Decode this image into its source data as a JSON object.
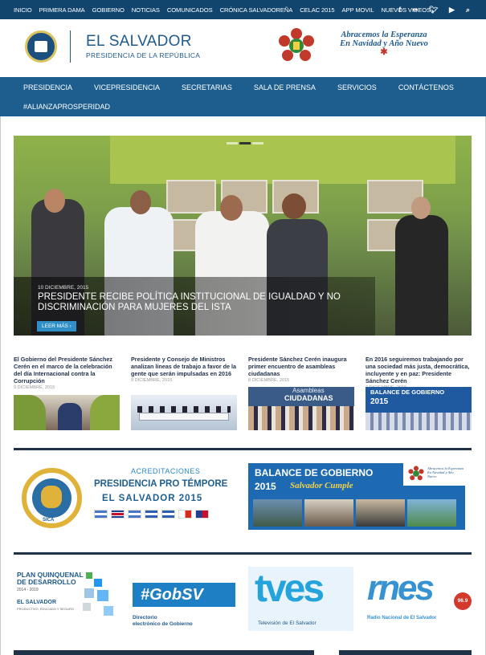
{
  "topbar": {
    "links": [
      "INICIO",
      "PRIMERA DAMA",
      "GOBIERNO",
      "NOTICIAS",
      "COMUNICADOS",
      "CRÓNICA SALVADOREÑA",
      "CELAC 2015",
      "APP MOVIL",
      "NUEVOS VIDEOS"
    ],
    "social_icons": [
      "facebook-icon",
      "flickr-icon",
      "twitter-icon",
      "youtube-icon",
      "search-icon"
    ]
  },
  "header": {
    "title": "EL SALVADOR",
    "subtitle": "PRESIDENCIA DE LA REPÚBLICA",
    "campaign_line1": "Abracemos la Esperanza",
    "campaign_line2": "En Navidad y Año Nuevo"
  },
  "mainnav": {
    "items": [
      "PRESIDENCIA",
      "VICEPRESIDENCIA",
      "SECRETARIAS",
      "SALA DE PRENSA",
      "SERVICIOS",
      "CONTÁCTENOS"
    ],
    "row2": "#ALIANZAPROSPERIDAD"
  },
  "slider": {
    "date": "10 DICIEMBRE, 2015",
    "title": "PRESIDENTE RECIBE POLÍTICA INSTITUCIONAL DE IGUALDAD Y NO DISCRIMINACIÓN PARA MUJERES DEL ISTA",
    "read_more": "LEER MÁS ›"
  },
  "news": [
    {
      "title": "El Gobierno del Presidente Sánchez Cerén en el marco de la celebración del día Internacional contra la Corrupción",
      "date": "9 DICIEMBRE, 2015"
    },
    {
      "title": "Presidente y Consejo de Ministros analizan líneas de trabajo a favor de la gente que serán impulsadas en 2016",
      "date": "9 DICIEMBRE, 2015"
    },
    {
      "title": "Presidente Sánchez Cerén inaugura primer encuentro de asambleas ciudadanas",
      "date": "8 DICIEMBRE, 2015",
      "thumb_text_1": "Asambleas",
      "thumb_text_2": "CIUDADANAS"
    },
    {
      "title": "En 2016 seguiremos trabajando por una sociedad más justa, democrática, incluyente y en paz: Presidente Sánchez Cerén",
      "date": "7 DICIEMBRE, 2015",
      "thumb_text_1": "BALANCE DE GOBIERNO",
      "thumb_text_2": "2015"
    }
  ],
  "banners": {
    "acc_label": "ACREDITACIONES",
    "acc_line1": "PRESIDENCIA PRO TÉMPORE",
    "acc_line2": "EL SALVADOR 2015",
    "sica_label": "SICA",
    "balance_title": "BALANCE DE GOBIERNO",
    "balance_year": "2015",
    "balance_slogan": "Salvador Cumple",
    "balance_campaign": "Abracemos la Esperanza En Navidad y Año Nuevo"
  },
  "logos": {
    "plan_line1": "PLAN QUINQUENAL",
    "plan_line2": "DE DESARROLLO",
    "plan_years": "2014 - 2019",
    "plan_country": "EL SALVADOR",
    "plan_tagline": "PRODUCTIVO, EDUCADO Y SEGURO",
    "gob_label": "#GobSV",
    "gob_sub1": "Directorio",
    "gob_sub2": "electrónico de Gobierno",
    "tv_label": "tves",
    "tv_sub": "Televisión de El Salvador",
    "radio_label": "rnes",
    "radio_fm": "96.9 fm",
    "radio_sub": "Radio Nacional de El Salvador"
  },
  "colors": {
    "topbar": "#12456e",
    "nav": "#1d5e8f",
    "accent": "#2f8fc6"
  }
}
